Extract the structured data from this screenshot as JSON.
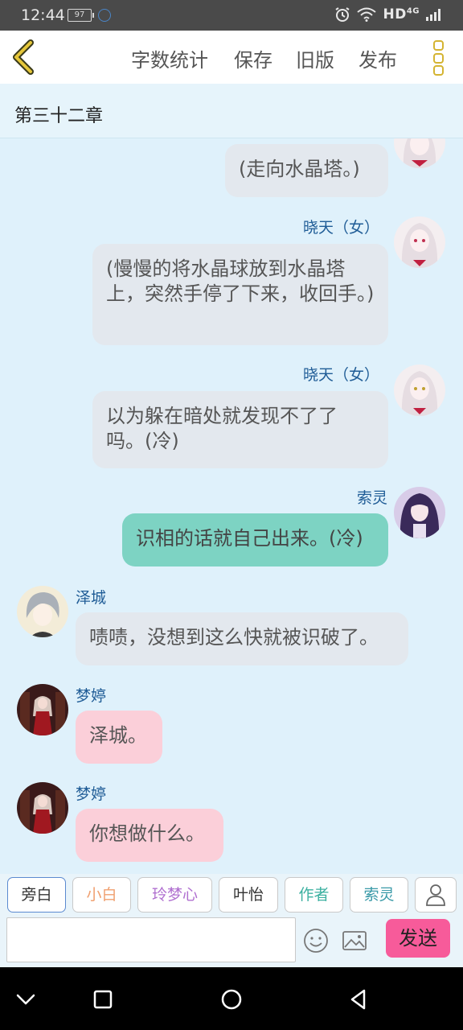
{
  "status_bar": {
    "time": "12:44",
    "battery": "97",
    "network": "HD",
    "network_gen": "4G"
  },
  "app_bar": {
    "word_count_label": "字数统计",
    "save_label": "保存",
    "old_version_label": "旧版",
    "publish_label": "发布"
  },
  "chapter": {
    "title": "第三十二章"
  },
  "messages": [
    {
      "side": "right",
      "speaker": "",
      "text": "(走向水晶塔。)",
      "color": "gray"
    },
    {
      "side": "right",
      "speaker": "晓天（女）",
      "text": "(慢慢的将水晶球放到水晶塔上，突然手停了下来，收回手。)",
      "color": "gray"
    },
    {
      "side": "right",
      "speaker": "晓天（女）",
      "text": "以为躲在暗处就发现不了了吗。(冷)",
      "color": "gray"
    },
    {
      "side": "right",
      "speaker": "索灵",
      "text": "识相的话就自己出来。(冷)",
      "color": "teal"
    },
    {
      "side": "left",
      "speaker": "泽城",
      "text": "啧啧，没想到这么快就被识破了。",
      "color": "gray"
    },
    {
      "side": "left",
      "speaker": "梦婷",
      "text": "泽城。",
      "color": "pink"
    },
    {
      "side": "left",
      "speaker": "梦婷",
      "text": "你想做什么。",
      "color": "pink"
    }
  ],
  "characters": [
    {
      "label": "旁白",
      "color": "#333333"
    },
    {
      "label": "小白",
      "color": "#f0a070"
    },
    {
      "label": "玲梦心",
      "color": "#b070d0"
    },
    {
      "label": "叶怡",
      "color": "#333333"
    },
    {
      "label": "作者",
      "color": "#3bb0a0"
    },
    {
      "label": "索灵",
      "color": "#3a9aa8"
    }
  ],
  "input": {
    "placeholder": "",
    "value": ""
  },
  "send_label": "发送",
  "colors": {
    "bubble_gray": "#e3e8ee",
    "bubble_teal": "#7dd3c3",
    "bubble_pink": "#fbcfd9",
    "send": "#f75b9a",
    "accent": "#d4b432"
  }
}
